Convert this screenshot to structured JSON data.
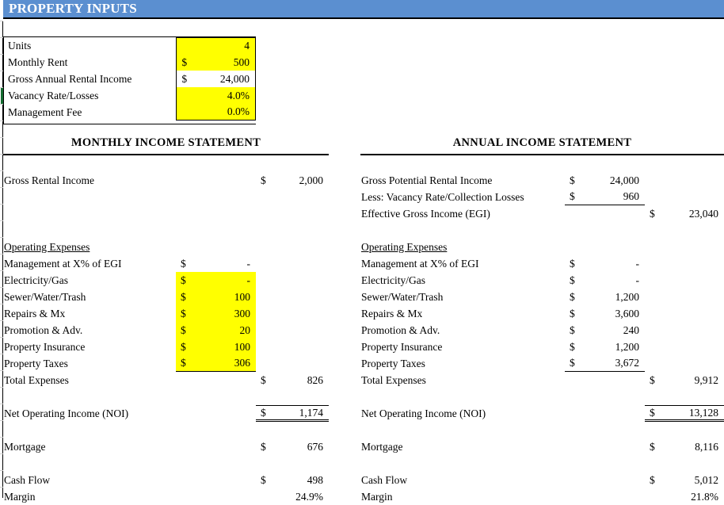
{
  "header": {
    "title": "PROPERTY INPUTS",
    "band_color": "#5B8FD0",
    "text_color": "#FFFFFF"
  },
  "highlight_color": "#FFFF00",
  "inputs": {
    "rows": [
      {
        "label": "Units",
        "currency": "",
        "value": "4",
        "highlighted": true
      },
      {
        "label": "Monthly Rent",
        "currency": "$",
        "value": "500",
        "highlighted": true
      },
      {
        "label": "Gross Annual Rental Income",
        "currency": "$",
        "value": "24,000",
        "highlighted": false
      },
      {
        "label": "Vacancy Rate/Losses",
        "currency": "",
        "value": "4.0%",
        "highlighted": true
      },
      {
        "label": "Management Fee",
        "currency": "",
        "value": "0.0%",
        "highlighted": true
      }
    ]
  },
  "monthly": {
    "title": "MONTHLY INCOME STATEMENT",
    "income": {
      "gross_rental_income_label": "Gross Rental Income",
      "gross_rental_income_currency": "$",
      "gross_rental_income_value": "2,000"
    },
    "expenses_heading": "Operating Expenses",
    "expenses": [
      {
        "label": "Management at X% of EGI",
        "currency": "$",
        "value": "-",
        "highlighted": false
      },
      {
        "label": "Electricity/Gas",
        "currency": "$",
        "value": "-",
        "highlighted": true
      },
      {
        "label": "Sewer/Water/Trash",
        "currency": "$",
        "value": "100",
        "highlighted": true
      },
      {
        "label": "Repairs & Mx",
        "currency": "$",
        "value": "300",
        "highlighted": true
      },
      {
        "label": "Promotion & Adv.",
        "currency": "$",
        "value": "20",
        "highlighted": true
      },
      {
        "label": "Property Insurance",
        "currency": "$",
        "value": "100",
        "highlighted": true
      },
      {
        "label": "Property Taxes",
        "currency": "$",
        "value": "306",
        "highlighted": true
      }
    ],
    "total_expenses_label": "Total Expenses",
    "total_expenses_currency": "$",
    "total_expenses_value": "826",
    "noi_label": "Net Operating Income (NOI)",
    "noi_currency": "$",
    "noi_value": "1,174",
    "mortgage_label": "Mortgage",
    "mortgage_currency": "$",
    "mortgage_value": "676",
    "cash_flow_label": "Cash Flow",
    "cash_flow_currency": "$",
    "cash_flow_value": "498",
    "margin_label": "Margin",
    "margin_value": "24.9%"
  },
  "annual": {
    "title": "ANNUAL INCOME STATEMENT",
    "income": [
      {
        "label": "Gross Potential Rental Income",
        "currency": "$",
        "value": "24,000"
      },
      {
        "label": "Less:  Vacancy Rate/Collection Losses",
        "currency": "$",
        "value": "960"
      }
    ],
    "egi_label": "Effective Gross Income (EGI)",
    "egi_currency": "$",
    "egi_value": "23,040",
    "expenses_heading": "Operating Expenses",
    "expenses": [
      {
        "label": "Management at X% of EGI",
        "currency": "$",
        "value": "-"
      },
      {
        "label": "Electricity/Gas",
        "currency": "$",
        "value": "-"
      },
      {
        "label": "Sewer/Water/Trash",
        "currency": "$",
        "value": "1,200"
      },
      {
        "label": "Repairs & Mx",
        "currency": "$",
        "value": "3,600"
      },
      {
        "label": "Promotion & Adv.",
        "currency": "$",
        "value": "240"
      },
      {
        "label": "Property Insurance",
        "currency": "$",
        "value": "1,200"
      },
      {
        "label": "Property Taxes",
        "currency": "$",
        "value": "3,672"
      }
    ],
    "total_expenses_label": "Total Expenses",
    "total_expenses_currency": "$",
    "total_expenses_value": "9,912",
    "noi_label": "Net Operating Income (NOI)",
    "noi_currency": "$",
    "noi_value": "13,128",
    "mortgage_label": "Mortgage",
    "mortgage_currency": "$",
    "mortgage_value": "8,116",
    "cash_flow_label": "Cash Flow",
    "cash_flow_currency": "$",
    "cash_flow_value": "5,012",
    "margin_label": "Margin",
    "margin_value": "21.8%"
  }
}
